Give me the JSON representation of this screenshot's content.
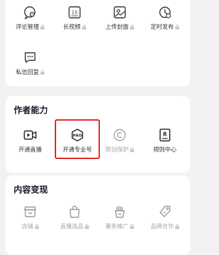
{
  "top_tools": [
    {
      "label": "评论管理",
      "icon": "comment-settings-icon",
      "locked": true
    },
    {
      "label": "长视频",
      "icon": "calendar-15-icon",
      "icon_text": "15",
      "locked": true
    },
    {
      "label": "上传封面",
      "icon": "image-icon",
      "locked": true
    },
    {
      "label": "定时发布",
      "icon": "clock-icon",
      "locked": true
    },
    {
      "label": "私信回复",
      "icon": "message-icon",
      "locked": true
    }
  ],
  "creator": {
    "title": "作者能力",
    "items": [
      {
        "label": "开通直播",
        "icon": "live-camera-icon",
        "locked": false
      },
      {
        "label": "开通专业号",
        "icon": "pro-badge-icon",
        "icon_text": "PRO",
        "locked": false
      },
      {
        "label": "原创保护",
        "icon": "copyright-icon",
        "locked": true
      },
      {
        "label": "规则中心",
        "icon": "rules-book-icon",
        "locked": false
      }
    ]
  },
  "monetize": {
    "title": "内容变现",
    "items": [
      {
        "label": "店铺",
        "icon": "shop-icon",
        "locked": true
      },
      {
        "label": "直播选品",
        "icon": "shopping-bag-icon",
        "locked": true
      },
      {
        "label": "薯条推广",
        "icon": "fries-icon",
        "locked": true
      },
      {
        "label": "品牌合作",
        "icon": "brand-tag-icon",
        "locked": true
      }
    ]
  },
  "colors": {
    "highlight": "#e5231f",
    "muted": "#a6a7ab"
  }
}
